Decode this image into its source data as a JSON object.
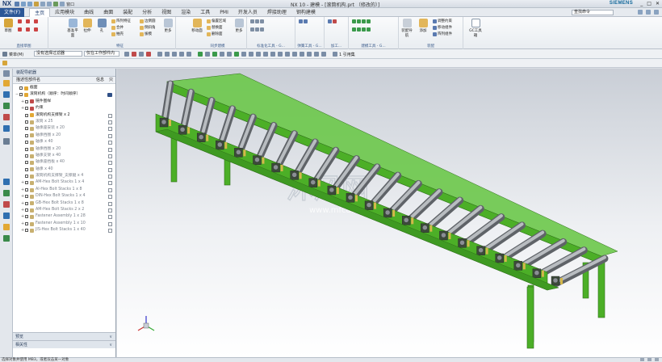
{
  "titlebar": {
    "logo": "NX",
    "window_label": "窗口",
    "title": "NX 10 - 建模 - [滚筒机构.prt （修改的）]",
    "brand": "SIEMENS",
    "controls": [
      "_",
      "□",
      "✕"
    ]
  },
  "tabs": {
    "file": "文件(F)",
    "items": [
      "主页",
      "应用模块",
      "曲线",
      "曲面",
      "装配",
      "分析",
      "视图",
      "渲染",
      "工具",
      "PMI",
      "开发人员",
      "焊接助理",
      "钢构建模"
    ],
    "active": "主页",
    "search_placeholder": "查找命令"
  },
  "ribbon": {
    "groups": [
      {
        "label": "直接草图",
        "buttons": [
          "草图",
          "完成"
        ]
      },
      {
        "label": "特征",
        "buttons": [
          "基准平面",
          "拉伸",
          "孔",
          "阵列特征",
          "合并",
          "抽壳",
          "边倒圆",
          "倒斜角",
          "拔模",
          "更多"
        ]
      },
      {
        "label": "同步建模",
        "buttons": [
          "移动面",
          "偏置区域",
          "替换面",
          "删除面",
          "更多"
        ]
      },
      {
        "label": "标准化工具 - G...",
        "buttons": [
          "齿轮建模 - G..."
        ]
      },
      {
        "label": "弹簧工具 - G...",
        "buttons": []
      },
      {
        "label": "加工...",
        "buttons": []
      },
      {
        "label": "建模工具 - G...",
        "buttons": []
      },
      {
        "label": "装配",
        "buttons": [
          "装配导航",
          "添加",
          "调整约束",
          "移动组件",
          "阵列组件"
        ]
      },
      {
        "label": "GC工具箱",
        "buttons": [
          "GC工具箱"
        ]
      }
    ]
  },
  "toolbar": {
    "menu_label": "菜单(M)",
    "filter_value": "没有选择过滤器",
    "scope_value": "仅在工作部件内",
    "snap_label": "1 引用集"
  },
  "navigator": {
    "title": "装配导航器",
    "columns": {
      "name": "描述性部件名",
      "info": "信息",
      "open": "只"
    },
    "rows": [
      {
        "label": "截面",
        "level": 0,
        "expand": "",
        "grey": false
      },
      {
        "label": "滚筒机构（顺序：时间顺序）",
        "level": 0,
        "expand": "−",
        "grey": false,
        "saved": true
      },
      {
        "label": "链件图样",
        "level": 1,
        "expand": "+",
        "grey": false
      },
      {
        "label": "约束",
        "level": 1,
        "expand": "+",
        "grey": false
      },
      {
        "label": "滚筒机构支撑架 x 2",
        "level": 1,
        "expand": "",
        "grey": false
      },
      {
        "label": "滚筒 x 25",
        "level": 1,
        "expand": "",
        "grey": true
      },
      {
        "label": "轴承座安装 x 20",
        "level": 1,
        "expand": "",
        "grey": true
      },
      {
        "label": "轴承挡圈 x 20",
        "level": 1,
        "expand": "",
        "grey": true
      },
      {
        "label": "轴承 x 40",
        "level": 1,
        "expand": "",
        "grey": true
      },
      {
        "label": "轴承挡圈 x 20",
        "level": 1,
        "expand": "",
        "grey": true
      },
      {
        "label": "轴承支架 x 40",
        "level": 1,
        "expand": "",
        "grey": true
      },
      {
        "label": "轴承座挡板 x 40",
        "level": 1,
        "expand": "",
        "grey": true
      },
      {
        "label": "轴承 x 40",
        "level": 1,
        "expand": "",
        "grey": true
      },
      {
        "label": "滚筒机构支撑架_支撑腿 x 4",
        "level": 1,
        "expand": "",
        "grey": true
      },
      {
        "label": "AM-Hex Bolt Stacks 1 x 4",
        "level": 1,
        "expand": "+",
        "grey": true
      },
      {
        "label": "AI-Hex Bolt Stacks 1 x 8",
        "level": 1,
        "expand": "+",
        "grey": true
      },
      {
        "label": "DIN-Hex Bolt Stacks 1 x 4",
        "level": 1,
        "expand": "+",
        "grey": true
      },
      {
        "label": "GB-Hex Bolt Stacks 1 x 8",
        "level": 1,
        "expand": "+",
        "grey": true
      },
      {
        "label": "AM-Hex Bolt Stacks 2 x 2",
        "level": 1,
        "expand": "+",
        "grey": true
      },
      {
        "label": "Fastener Assembly 1 x 28",
        "level": 1,
        "expand": "+",
        "grey": true
      },
      {
        "label": "Fastener Assembly 1 x 10",
        "level": 1,
        "expand": "+",
        "grey": true
      },
      {
        "label": "JIS-Hex Bolt Stacks 1 x 40",
        "level": 1,
        "expand": "+",
        "grey": true
      }
    ],
    "bottom_panels": [
      "预览",
      "相关性"
    ]
  },
  "watermark": {
    "text": "沐风网",
    "url": "www.mfcad.com"
  },
  "status": {
    "message": "选择对象并使用 MB3，或者双击某一对象"
  },
  "colors": {
    "frame_green": "#4caf27",
    "frame_dark": "#2f6f1a",
    "roller": "#8f9499",
    "accent": "#2b5797"
  }
}
